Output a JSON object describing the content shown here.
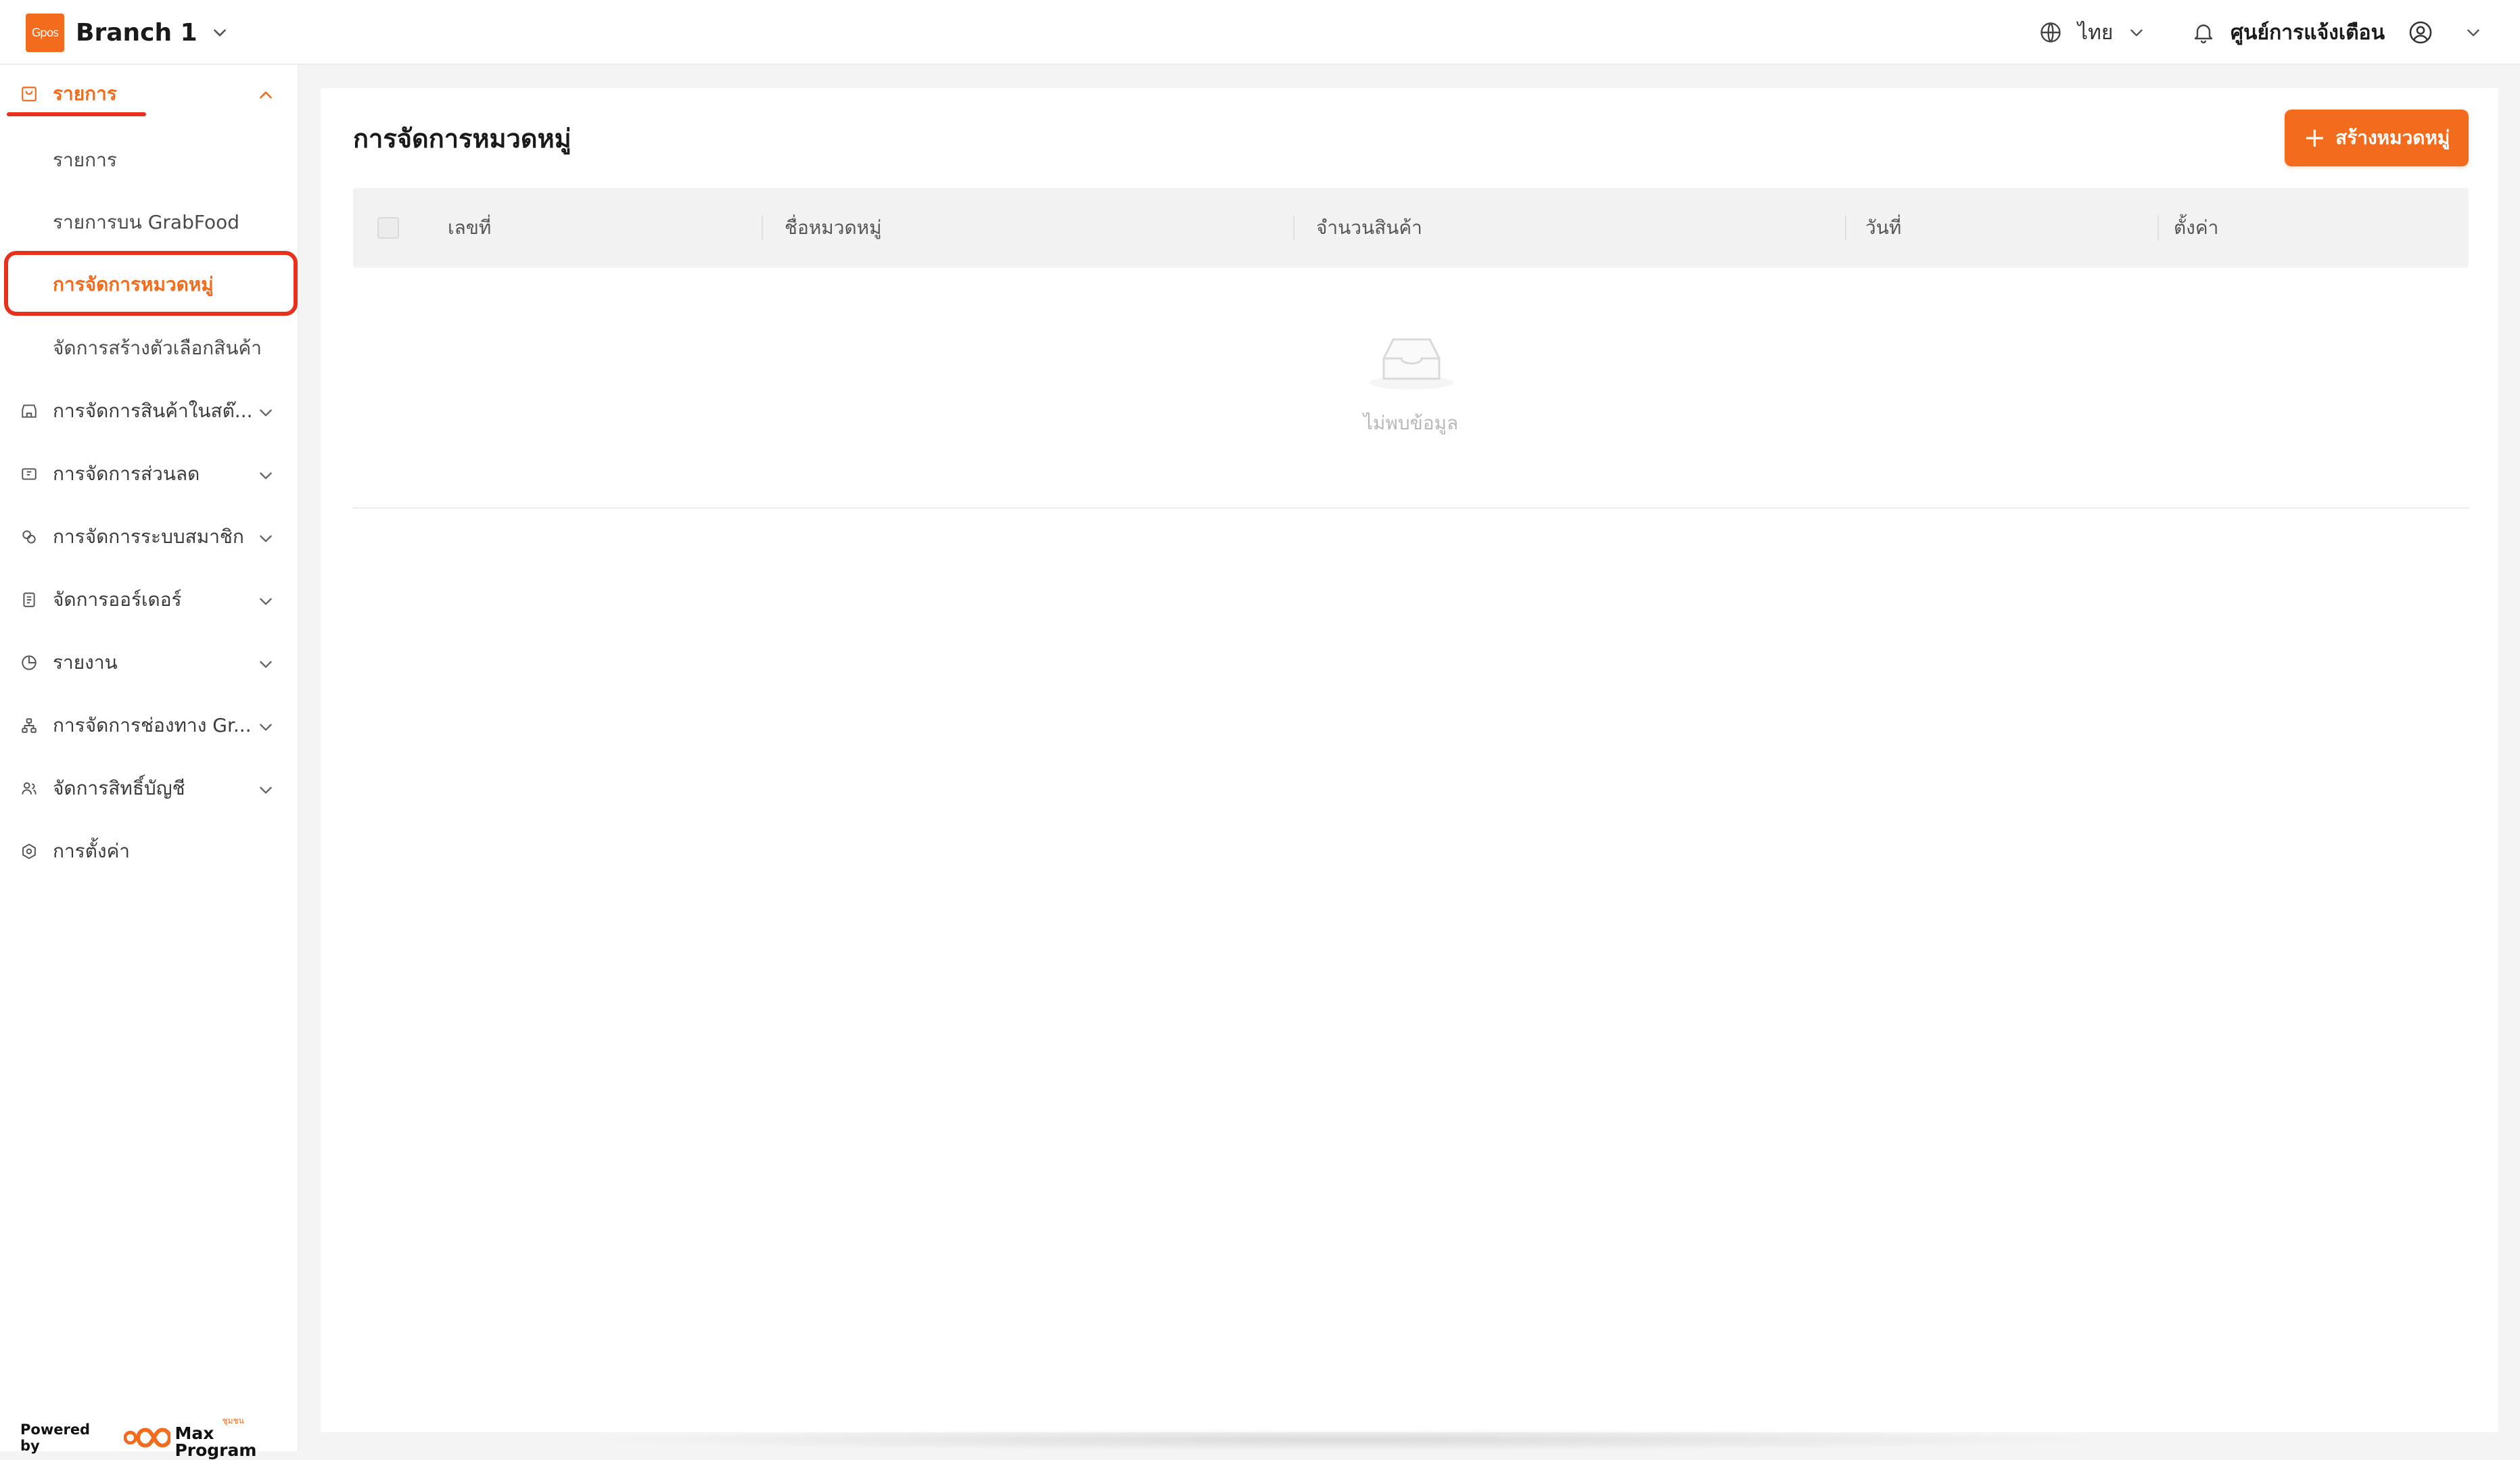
{
  "header": {
    "logo_text": "Gpos",
    "branch_name": "Branch 1",
    "language": "ไทย",
    "notifications_label": "ศูนย์การแจ้งเตือน"
  },
  "sidebar": {
    "menu_open": {
      "label": "รายการ",
      "children": [
        {
          "label": "รายการ"
        },
        {
          "label": "รายการบน GrabFood"
        },
        {
          "label": "การจัดการหมวดหมู่"
        },
        {
          "label": "จัดการสร้างตัวเลือกสินค้า"
        }
      ]
    },
    "menus": [
      {
        "label": "การจัดการสินค้าในสต๊...",
        "icon": "store-icon"
      },
      {
        "label": "การจัดการส่วนลด",
        "icon": "ticket-icon"
      },
      {
        "label": "การจัดการระบบสมาชิก",
        "icon": "membership-icon"
      },
      {
        "label": "จัดการออร์เดอร์",
        "icon": "clipboard-icon"
      },
      {
        "label": "รายงาน",
        "icon": "pie-chart-icon"
      },
      {
        "label": "การจัดการช่องทาง Gr...",
        "icon": "channel-icon"
      },
      {
        "label": "จัดการสิทธิ์บัญชี",
        "icon": "users-icon"
      },
      {
        "label": "การตั้งค่า",
        "icon": "settings-icon"
      }
    ],
    "powered_by": "Powered by",
    "brand_sub": "ชุมชน",
    "brand_name": "Max Program"
  },
  "main": {
    "title": "การจัดการหมวดหมู่",
    "create_button": "สร้างหมวดหมู่",
    "table": {
      "columns": [
        "เลขที่",
        "ชื่อหมวดหมู่",
        "จำนวนสินค้า",
        "วันที่",
        "ตั้งค่า"
      ]
    },
    "empty_text": "ไม่พบข้อมูล"
  },
  "colors": {
    "accent": "#f36b1c",
    "highlight": "#e8301c"
  }
}
